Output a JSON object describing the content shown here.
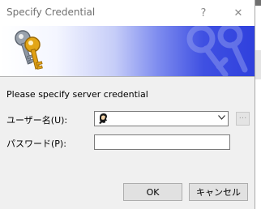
{
  "window": {
    "title": "Specify Credential",
    "help_glyph": "?",
    "close_glyph": "✕"
  },
  "banner": {
    "icon": "keys-icon",
    "watermark_icon": "keys-watermark-icon"
  },
  "form": {
    "prompt": "Please specify server credential",
    "user_label": "ユーザー名(U):",
    "user_value": "",
    "user_icon": "user-icon",
    "browse_label": "...",
    "password_label": "パスワード(P):",
    "password_value": ""
  },
  "buttons": {
    "ok": "OK",
    "cancel": "キャンセル"
  }
}
